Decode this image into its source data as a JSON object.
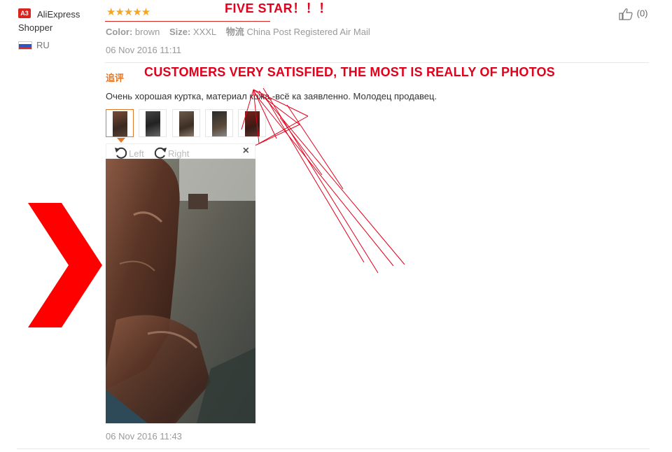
{
  "user": {
    "badge": "A3",
    "name": "AliExpress Shopper",
    "country": "RU"
  },
  "review": {
    "stars": "★★★★★",
    "rating": 5,
    "color_label": "Color:",
    "color_value": "brown",
    "size_label": "Size:",
    "size_value": "XXXL",
    "shipping_label": "物流",
    "shipping_value": "China Post Registered Air Mail",
    "date": "06 Nov 2016 11:11",
    "like_count": "(0)"
  },
  "followup": {
    "tag": "追评",
    "text": "Очень хорошая куртка, материал кожа,-всё ка заявленно. Молодец продавец.",
    "thumbnail_count": 5,
    "viewer": {
      "left_label": "Left",
      "right_label": "Right",
      "close_symbol": "×"
    },
    "date": "06 Nov 2016 11:43"
  },
  "annotations": {
    "five_star": "FIVE STAR！！！",
    "customers": "CUSTOMERS VERY SATISFIED, THE MOST IS REALLY OF PHOTOS",
    "color": "#e3001b"
  },
  "colors": {
    "star": "#f5a623",
    "accent": "#e4782a",
    "annotation_red": "#e3001b",
    "muted": "#999999"
  },
  "icons": {
    "like": "thumbs-up-icon",
    "rotate_left": "rotate-left-icon",
    "rotate_right": "rotate-right-icon",
    "close": "close-icon",
    "arrow": "big-red-chevron-icon"
  }
}
